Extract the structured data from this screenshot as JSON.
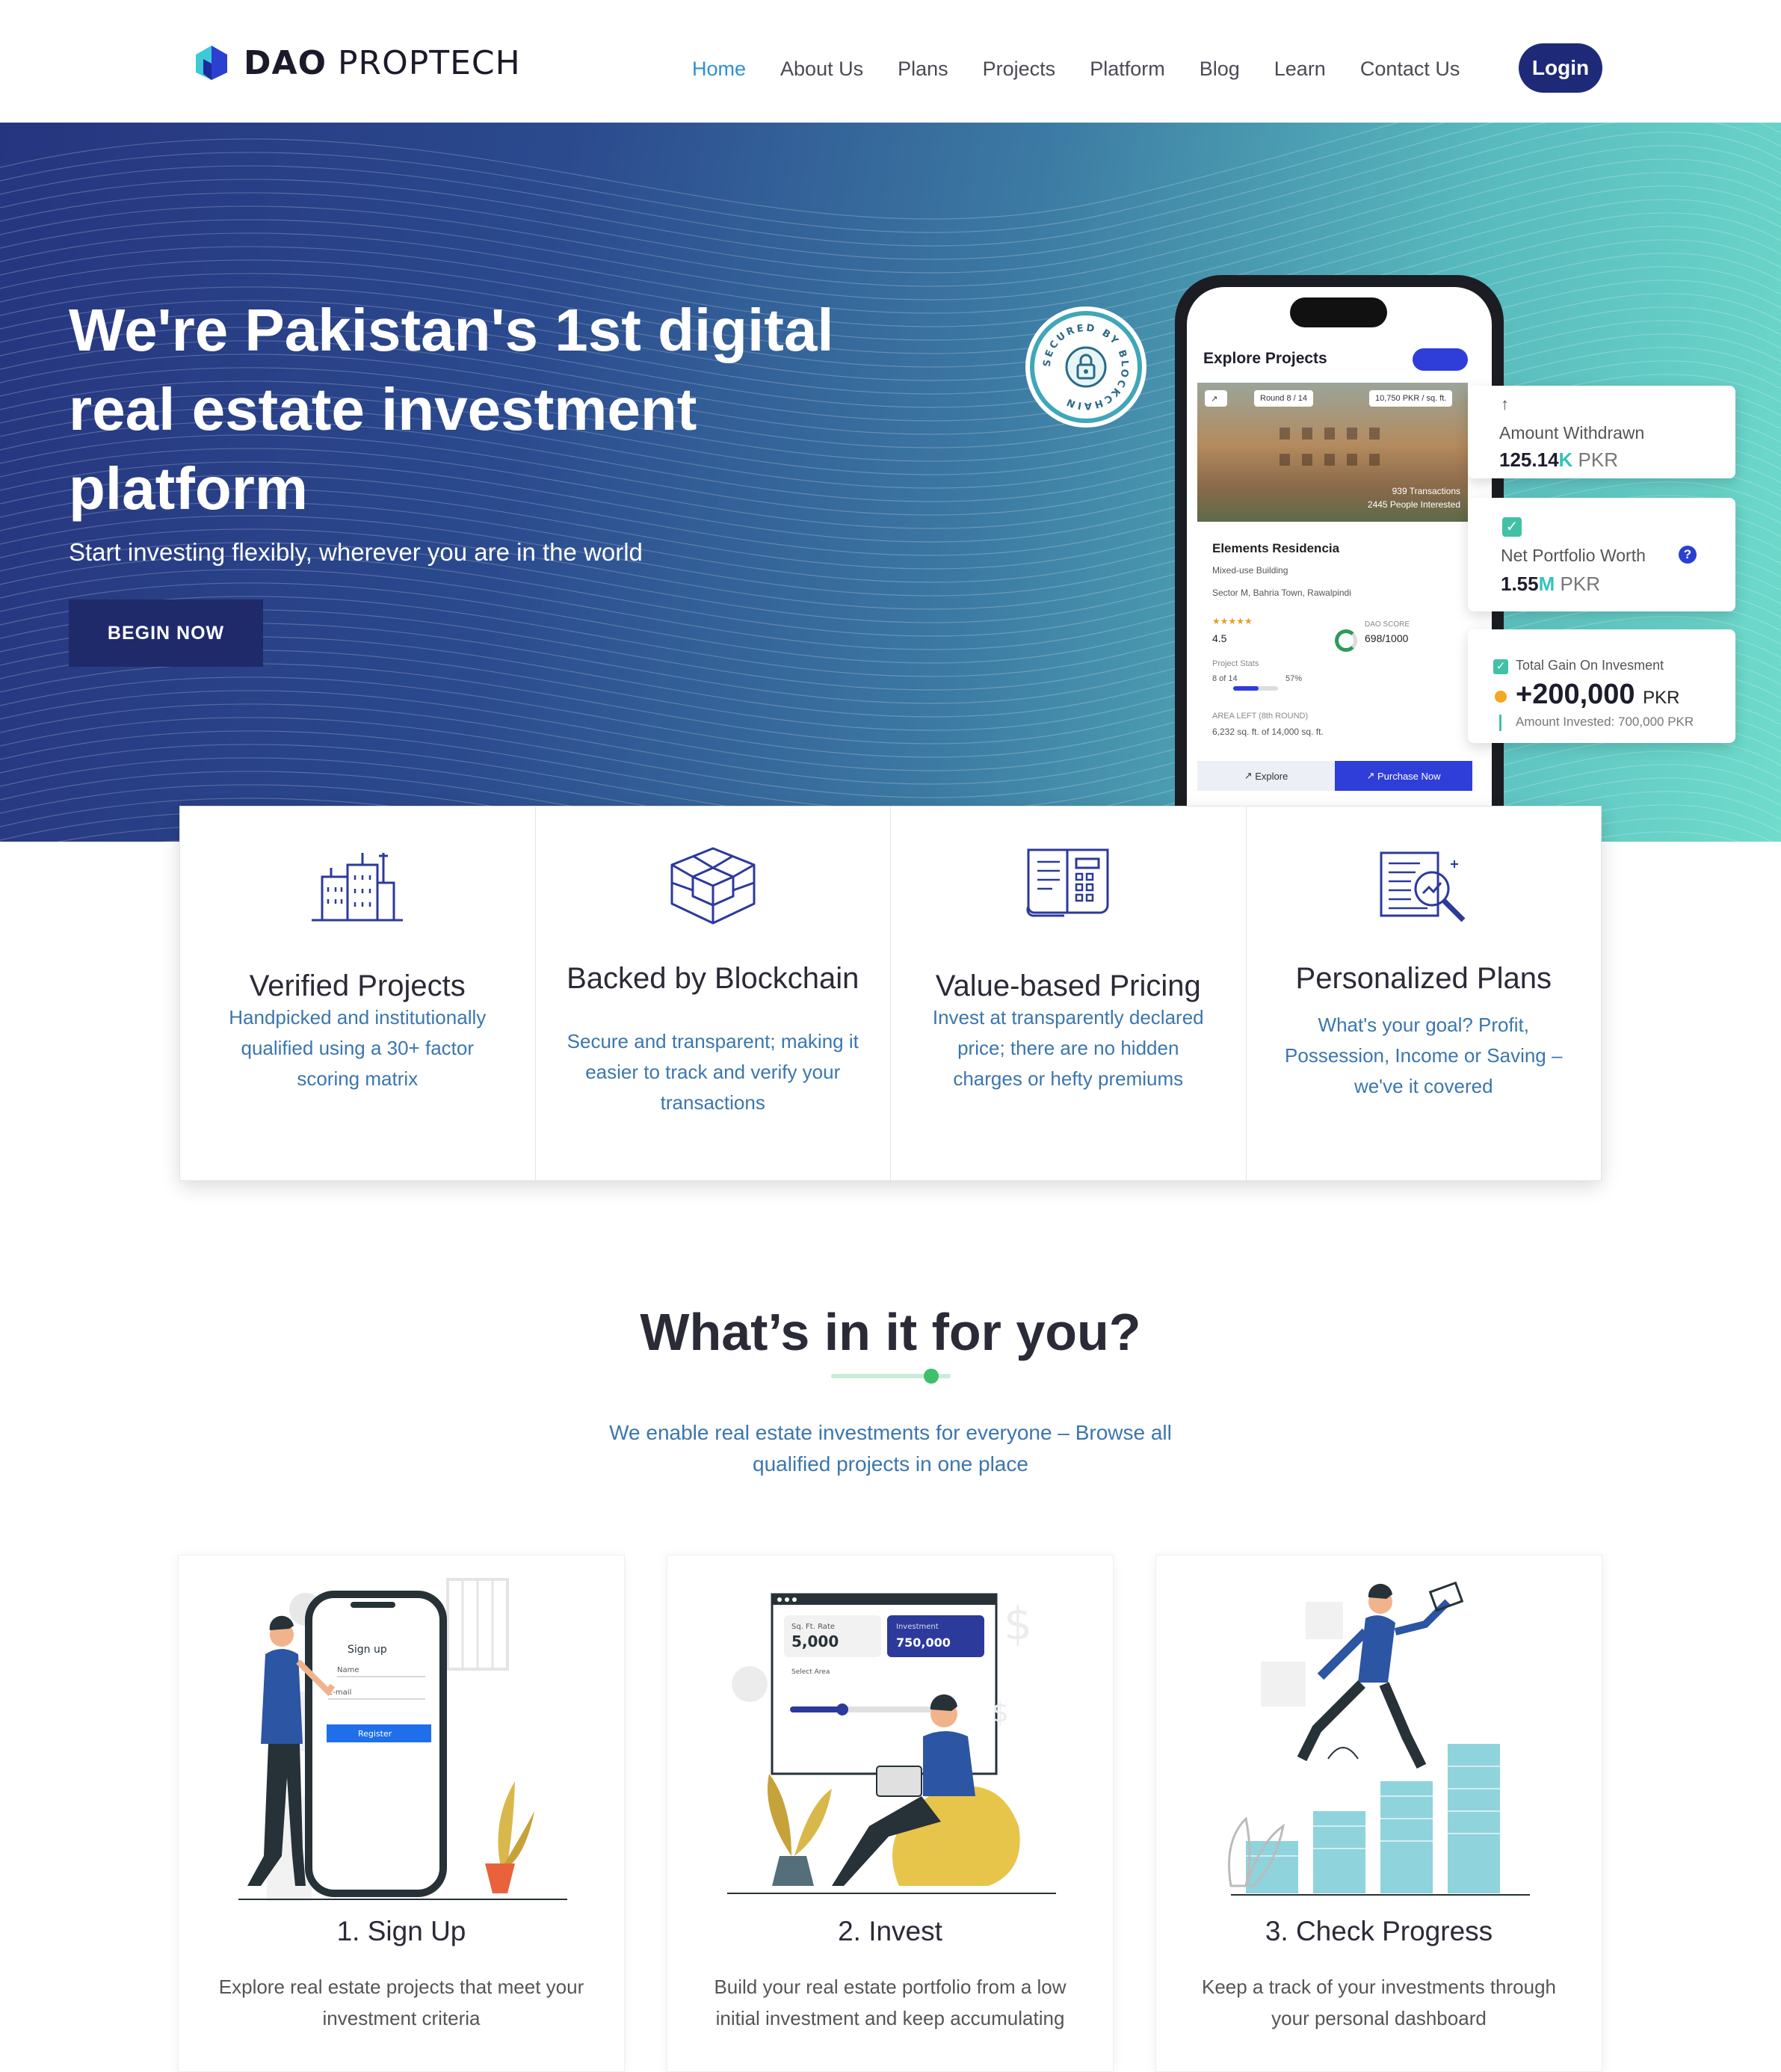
{
  "brand": {
    "bold": "DAO",
    "light": "PROPTECH",
    "mark_colors": [
      "#3ec9d6",
      "#2b3fd1"
    ]
  },
  "nav": {
    "items": [
      "Home",
      "About Us",
      "Plans",
      "Projects",
      "Platform",
      "Blog",
      "Learn",
      "Contact Us"
    ],
    "active": "Home",
    "login_label": "Login"
  },
  "hero": {
    "title": "We're Pakistan's 1st digital real estate investment platform",
    "subtitle": "Start investing flexibly, wherever you are in the world",
    "cta_label": "BEGIN NOW",
    "seal_text": "SECURED BY BLOCKCHAIN"
  },
  "phone": {
    "header": "Explore Projects",
    "tag_round": "Round 8 / 14",
    "tag_rate": "10,750 PKR / sq. ft.",
    "transactions": "939 Transactions",
    "interested": "2445 People Interested",
    "project_name": "Elements Residencia",
    "project_type": "Mixed-use Building",
    "project_location": "Sector M, Bahria Town, Rawalpindi",
    "rating": "4.5",
    "dao_score_label": "DAO SCORE",
    "dao_score": "698/1000",
    "stats_label": "Project Stats",
    "stats_rounds": "8 of 14",
    "stats_percent": "57%",
    "area_label": "AREA LEFT (8th ROUND)",
    "area_value": "6,232 sq. ft. of 14,000 sq. ft.",
    "explore_label": "Explore",
    "purchase_label": "Purchase Now"
  },
  "stats": {
    "withdrawn_label": "Amount Withdrawn",
    "withdrawn_num": "125.14",
    "withdrawn_unit": "K",
    "withdrawn_cur": "PKR",
    "portfolio_label": "Net Portfolio Worth",
    "portfolio_num": "1.55",
    "portfolio_unit": "M",
    "portfolio_cur": "PKR",
    "gain_label": "Total Gain On Invesment",
    "gain_value": "+200,000",
    "gain_cur": "PKR",
    "invested_label": "Amount Invested: 700,000 PKR"
  },
  "features": [
    {
      "title": "Verified Projects",
      "text": "Handpicked and institutionally qualified using a 30+ factor scoring matrix",
      "icon": "building-icon"
    },
    {
      "title": "Backed by Blockchain",
      "text": "Secure and transparent; making it easier to track and verify your transactions",
      "icon": "blockchain-cubes-icon"
    },
    {
      "title": "Value-based Pricing",
      "text": "Invest at transparently declared price; there are no hidden charges or hefty premiums",
      "icon": "price-document-icon"
    },
    {
      "title": "Personalized Plans",
      "text": "What's your goal? Profit, Possession, Income or Saving – we've it covered",
      "icon": "analysis-magnifier-icon"
    }
  ],
  "benefits": {
    "title": "What’s in it for you?",
    "subtitle": "We enable real estate investments for everyone – Browse all qualified projects in one place",
    "accent": "#3fbf6c"
  },
  "steps": [
    {
      "title": "1. Sign Up",
      "text": "Explore real estate projects that meet your investment criteria",
      "illus": {
        "heading": "Sign up",
        "name": "Name",
        "email": "E-mail",
        "button": "Register"
      }
    },
    {
      "title": "2. Invest",
      "text": "Build your real estate portfolio from a low initial investment and keep accumulating",
      "illus": {
        "rate_label": "Sq. Ft. Rate",
        "rate": "5,000",
        "inv_label": "Investment",
        "inv": "750,000",
        "select": "Select Area"
      }
    },
    {
      "title": "3. Check Progress",
      "text": "Keep a track of your investments through your personal dashboard"
    }
  ]
}
